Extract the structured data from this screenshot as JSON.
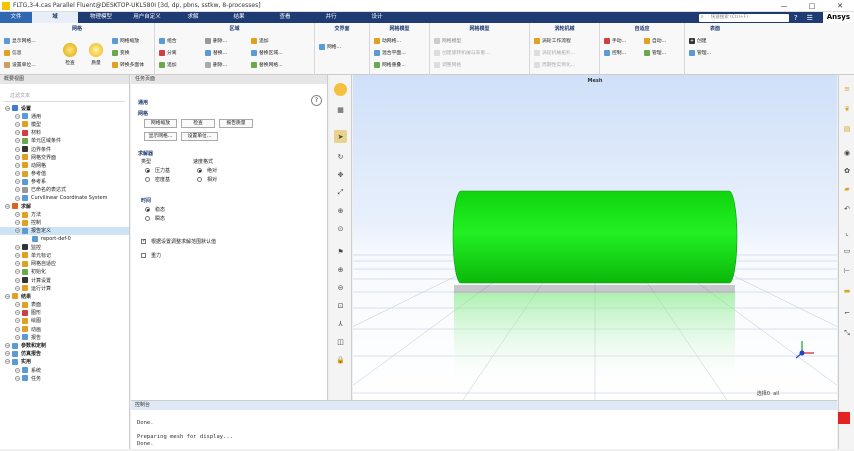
{
  "window": {
    "title": "FLTG,3-4.cas Parallel Fluent@DESKTOP-UKL580I  [3d, dp, pbns, sstkw, 8-processes]",
    "controls": [
      "—",
      "□",
      "✕"
    ]
  },
  "menubar": {
    "tabs": [
      "文件",
      "域",
      "物理模型",
      "用户自定义",
      "求解",
      "结果",
      "查看",
      "并行",
      "设计"
    ],
    "active_index": 1,
    "search_placeholder": "快速搜索 (Ctrl+F)",
    "brand": "Ansys"
  },
  "ribbon": {
    "groups": [
      {
        "title": "网格",
        "items": [
          "显示网格...",
          "信息",
          "设置单位...",
          "检查",
          "质量",
          "网格缩放",
          "变换",
          "转换多面体"
        ]
      },
      {
        "title": "区域",
        "items": [
          "组合",
          "分离",
          "追加",
          "删除...",
          "替换...",
          "删除...",
          "追加",
          "替换区域...",
          "替换网格..."
        ]
      },
      {
        "title": "交界面",
        "items": [
          "网格..."
        ]
      },
      {
        "title": "网格模型",
        "items": [
          "动网格...",
          "混合平面...",
          "网格重叠..."
        ]
      },
      {
        "title": "网格模型 ",
        "items": [
          "网格模型",
          "创建旋转机械与非重...",
          "调整网格"
        ]
      },
      {
        "title": "涡轮机械",
        "items": [
          "涡轮工作流程",
          "涡轮机械拓扑...",
          "周期性实例化..."
        ]
      },
      {
        "title": "自适应",
        "items": [
          "手动...",
          "自动...",
          "控制...",
          "管理..."
        ]
      },
      {
        "title": "表面",
        "items": [
          "创建",
          "管理..."
        ]
      }
    ]
  },
  "tree": {
    "header": "概要视图",
    "filter_placeholder": "过滤文本",
    "nodes": [
      {
        "label": "设置",
        "level": 0,
        "bold": true,
        "color": "#3a7bd5"
      },
      {
        "label": "通用",
        "level": 1,
        "color": "#5b9bd5"
      },
      {
        "label": "模型",
        "level": 1,
        "color": "#e0a020"
      },
      {
        "label": "材料",
        "level": 1,
        "color": "#d04040"
      },
      {
        "label": "单元区域条件",
        "level": 1,
        "color": "#6aa84f"
      },
      {
        "label": "边界条件",
        "level": 1,
        "color": "#333333"
      },
      {
        "label": "网格交界面",
        "level": 1,
        "color": "#e0a020"
      },
      {
        "label": "动网格",
        "level": 1,
        "color": "#e0a020"
      },
      {
        "label": "参考值",
        "level": 1,
        "color": "#e0a020"
      },
      {
        "label": "参考系",
        "level": 1,
        "color": "#5b9bd5"
      },
      {
        "label": "已命名的表达式",
        "level": 1,
        "color": "#999999"
      },
      {
        "label": "Curvilinear Coordinate System",
        "level": 1,
        "color": "#5b9bd5"
      },
      {
        "label": "求解",
        "level": 0,
        "bold": true,
        "color": "#e06020"
      },
      {
        "label": "方法",
        "level": 1,
        "color": "#e0a020"
      },
      {
        "label": "控制",
        "level": 1,
        "color": "#e0a020"
      },
      {
        "label": "报告定义",
        "level": 1,
        "color": "#5b9bd5",
        "selected": true
      },
      {
        "label": "report-def-0",
        "level": 2,
        "color": "#5b9bd5"
      },
      {
        "label": "监控",
        "level": 1,
        "color": "#333333"
      },
      {
        "label": "单元标记",
        "level": 1,
        "color": "#e0a020"
      },
      {
        "label": "网格自适应",
        "level": 1,
        "color": "#e0a020"
      },
      {
        "label": "初始化",
        "level": 1,
        "color": "#6aa84f"
      },
      {
        "label": "计算设置",
        "level": 1,
        "color": "#333333"
      },
      {
        "label": "运行计算",
        "level": 1,
        "color": "#e0a020"
      },
      {
        "label": "结果",
        "level": 0,
        "bold": true,
        "color": "#e0a020"
      },
      {
        "label": "表面",
        "level": 1,
        "color": "#e0a020"
      },
      {
        "label": "图形",
        "level": 1,
        "color": "#d04040"
      },
      {
        "label": "绘图",
        "level": 1,
        "color": "#e0a020"
      },
      {
        "label": "动画",
        "level": 1,
        "color": "#e0a020"
      },
      {
        "label": "报告",
        "level": 1,
        "color": "#5b9bd5"
      },
      {
        "label": "参数和定制",
        "level": 0,
        "bold": true,
        "color": "#5b9bd5"
      },
      {
        "label": "仿真报告",
        "level": 0,
        "bold": true,
        "color": "#5b9bd5"
      },
      {
        "label": "实用",
        "level": 0,
        "bold": true,
        "color": "#5b9bd5"
      },
      {
        "label": "系统",
        "level": 1,
        "color": "#5b9bd5"
      },
      {
        "label": "任务",
        "level": 1,
        "color": "#5b9bd5"
      }
    ]
  },
  "task": {
    "header": "任务页面",
    "section_title": "通用",
    "mesh_label": "网格",
    "buttons": [
      "网格缩放",
      "检查",
      "报告质量",
      "显示网格...",
      "设置单位..."
    ],
    "solver_label": "求解器",
    "type_label": "类型",
    "velocity_label": "速度格式",
    "type_options": [
      "压力基",
      "密度基"
    ],
    "velocity_options": [
      "绝对",
      "相对"
    ],
    "time_label": "时间",
    "time_options": [
      "稳态",
      "瞬态"
    ],
    "checkbox_label": "根据设置调整求解范围默认值",
    "gravity_label": "重力",
    "help": "?"
  },
  "viewport": {
    "title": "Mesh",
    "info_label": "选择0",
    "info_value": "all",
    "cylinder_color": "#13e613"
  },
  "console": {
    "header": "控制台",
    "lines": [
      "",
      "Done.",
      "",
      "Preparing mesh for display...",
      "Done."
    ]
  }
}
